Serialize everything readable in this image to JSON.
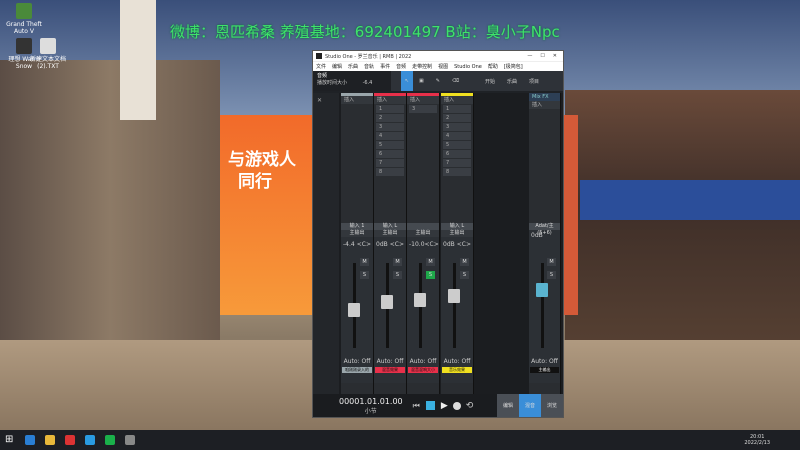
{
  "banner_text": "微博：恩匹希桑 养殖基地：692401497 B站：臭小子Npc",
  "desktop_icons": [
    {
      "label": "Grand Theft Auto V"
    },
    {
      "label": "理想 Warm Snow"
    },
    {
      "label": "新建文本文档 (2).TXT"
    }
  ],
  "poster": {
    "line1": "与游戏人",
    "line2": "同行"
  },
  "window": {
    "title": "Studio One - 罗兰音乐 | RMB | 2022",
    "menu": [
      "文件",
      "编辑",
      "乐曲",
      "音轨",
      "事件",
      "音频",
      "走带控制",
      "视图",
      "Studio One",
      "帮助",
      "[极简包]"
    ],
    "song_label": "音频",
    "song_sub": "播放时间大小",
    "tempo": "-6.4",
    "toolbar_right": [
      "开始",
      "乐曲",
      "项目"
    ],
    "mix_fx": "Mix FX",
    "insert_label": "插入",
    "channels": [
      {
        "name": "输入 1",
        "out": "主输出",
        "pan": "<C>",
        "vol": "-4.4",
        "label": "咱刚刚录入的",
        "color": "#9aa6ab",
        "slots": []
      },
      {
        "name": "输入 L",
        "out": "主输出",
        "pan": "<C>",
        "vol": "0dB",
        "label": "混音效果",
        "color": "#e8304a",
        "slots": [
          "1",
          "2",
          "3",
          "4",
          "5",
          "6",
          "7",
          "8"
        ]
      },
      {
        "name": "",
        "out": "主输出",
        "pan": "<C>",
        "vol": "-10.0",
        "label": "混音混响大小",
        "color": "#e8304a",
        "slots": [
          "3"
        ]
      },
      {
        "name": "输入 L",
        "out": "主输出",
        "pan": "<C>",
        "vol": "0dB",
        "label": "音乐效果",
        "color": "#f0e020",
        "slots": [
          "1",
          "2",
          "3",
          "4",
          "5",
          "6",
          "7",
          "8"
        ]
      }
    ],
    "main": {
      "name": "Adat/主(5+6)",
      "vol": "0dB",
      "label": "主输出",
      "auto": "Auto: Off"
    },
    "auto_label": "Auto: Off",
    "ms": [
      "M",
      "S"
    ],
    "timecode": "00001.01.01.00",
    "timecode_unit": "小节",
    "bottom_tabs": [
      "编辑",
      "混音",
      "浏览"
    ]
  },
  "taskbar": {
    "time": "20:01",
    "date": "2022/2/13"
  }
}
